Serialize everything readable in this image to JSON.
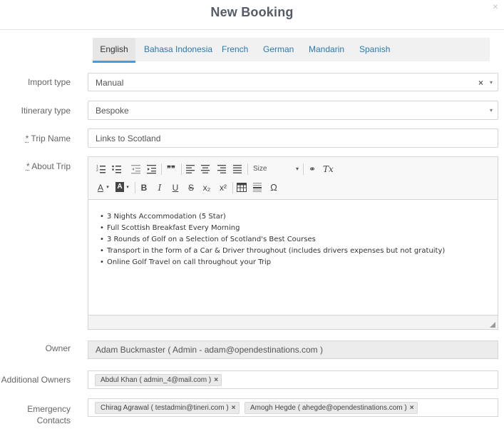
{
  "modal": {
    "title": "New Booking",
    "close": "×"
  },
  "tabs": [
    {
      "label": "English",
      "active": true
    },
    {
      "label": "Bahasa Indonesia"
    },
    {
      "label": "French"
    },
    {
      "label": "German"
    },
    {
      "label": "Mandarin"
    },
    {
      "label": "Spanish"
    }
  ],
  "form": {
    "import_type": {
      "label": "Import type",
      "value": "Manual",
      "clear": "×"
    },
    "itinerary_type": {
      "label": "Itinerary type",
      "value": "Bespoke"
    },
    "trip_name": {
      "required_mark": "*",
      "label": " Trip Name",
      "value": "Links to Scotland"
    },
    "about_trip": {
      "required_mark": "*",
      "label": " About Trip"
    },
    "owner": {
      "label": "Owner",
      "value": "Adam Buckmaster ( Admin - adam@opendestinations.com )"
    },
    "additional_owners": {
      "label": "Additional Owners",
      "chips": [
        {
          "text": "Abdul Khan ( admin_4@mail.com )",
          "remove": "×"
        }
      ]
    },
    "emergency_contacts": {
      "label_line1": "Emergency",
      "label_line2": "Contacts",
      "chips": [
        {
          "text": "Chirag Agrawal ( testadmin@tineri.com )",
          "remove": "×"
        },
        {
          "text": "Amogh Hegde ( ahegde@opendestinations.com )",
          "remove": "×"
        }
      ]
    }
  },
  "editor": {
    "size_label": "Size",
    "content_items": [
      "3 Nights Accommodation (5 Star)",
      "Full Scottish Breakfast Every Morning",
      "3 Rounds of Golf on a Selection of Scotland's Best Courses",
      "Transport in the form of a Car & Driver throughout (includes drivers expenses but not gratuity)",
      "Online Golf Travel on call throughout your Trip"
    ],
    "toolbar_icons": [
      "numbered-list-icon",
      "bulleted-list-icon",
      "outdent-icon",
      "indent-icon",
      "blockquote-icon",
      "align-left-icon",
      "align-center-icon",
      "align-right-icon",
      "justify-icon",
      "size-dropdown",
      "link-icon",
      "remove-format-icon",
      "text-color-icon",
      "background-color-icon",
      "bold-icon",
      "italic-icon",
      "underline-icon",
      "strikethrough-icon",
      "subscript-icon",
      "superscript-icon",
      "table-icon",
      "horizontal-rule-icon",
      "special-character-icon"
    ],
    "glyphs": {
      "blockquote": "❞❞",
      "text_color": "A",
      "bg_color": "A",
      "bold": "B",
      "italic": "I",
      "underline": "U",
      "strike": "S",
      "sub": "x₂",
      "sup": "x²",
      "omega": "Ω",
      "clear_fmt": "Tx",
      "link": "⚭",
      "caret": "▾"
    }
  },
  "colors": {
    "link": "#2a7ab0",
    "tab_indicator": "#4a9bd3",
    "title": "#555c66"
  }
}
